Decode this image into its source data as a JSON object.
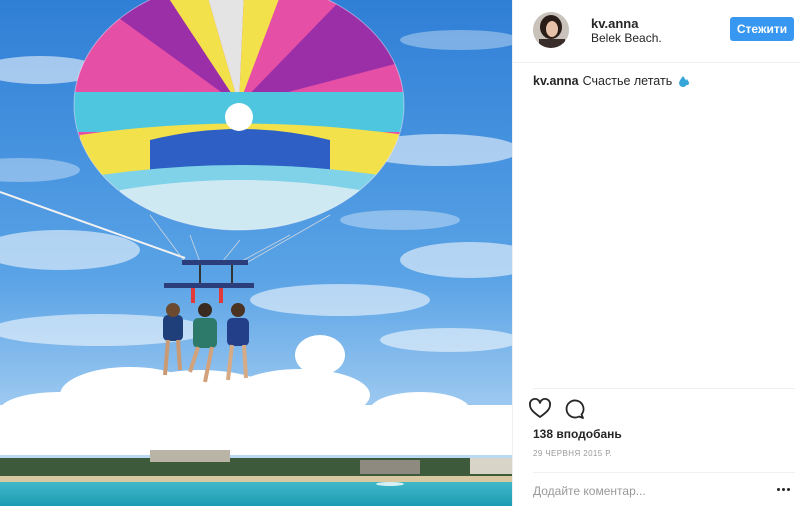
{
  "post": {
    "username": "kv.anna",
    "location": "Belek Beach.",
    "follow_label": "Стежити",
    "caption_user": "kv.anna",
    "caption_text": "Счастье летать",
    "likes": "138 вподобань",
    "date": "29 ЧЕРВНЯ 2015 Р.",
    "comment_placeholder": "Додайте коментар...",
    "icons": [
      "heart-icon",
      "comment-icon",
      "more-options-icon",
      "droplet-emoji-icon"
    ],
    "colors": {
      "follow_button": "#3897f0",
      "text": "#262626",
      "muted": "#999999"
    }
  }
}
